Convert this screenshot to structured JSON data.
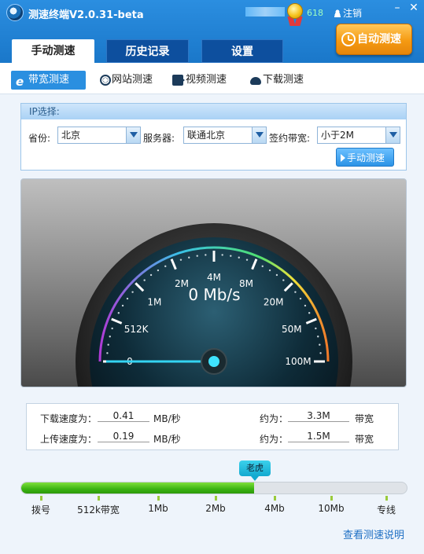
{
  "app": {
    "title": "测速终端V2.0.31-beta",
    "score": "618",
    "logout": "注销"
  },
  "tabs": [
    {
      "label": "手动测速"
    },
    {
      "label": "历史记录"
    },
    {
      "label": "设置"
    }
  ],
  "auto_button": "自动测速",
  "subtabs": [
    {
      "label": "带宽测速"
    },
    {
      "label": "网站测速"
    },
    {
      "label": "视频测速"
    },
    {
      "label": "下载测速"
    }
  ],
  "ip_panel": {
    "title": "IP选择:",
    "province_label": "省份:",
    "province_value": "北京",
    "server_label": "服务器:",
    "server_value": "联通北京",
    "bandwidth_label": "签约带宽:",
    "bandwidth_value": "小于2M",
    "manual_button": "手动测速"
  },
  "gauge": {
    "speed_text": "0 Mb/s",
    "labels": [
      "0",
      "512K",
      "1M",
      "2M",
      "4M",
      "8M",
      "20M",
      "50M",
      "100M"
    ],
    "needle_fraction": 0
  },
  "stats": {
    "download_label": "下载速度为：",
    "download_value": "0.41",
    "download_unit": "MB/秒",
    "upload_label": "上传速度为：",
    "upload_value": "0.19",
    "upload_unit": "MB/秒",
    "approx_label": "约为：",
    "download_bw": "3.3M",
    "upload_bw": "1.5M",
    "bw_unit": "带宽"
  },
  "level": {
    "bubble": "老虎",
    "fill_fraction": 0.605,
    "scale": [
      "拨号",
      "512k带宽",
      "1Mb",
      "2Mb",
      "4Mb",
      "10Mb",
      "专线"
    ]
  },
  "help_link": "查看测速说明"
}
